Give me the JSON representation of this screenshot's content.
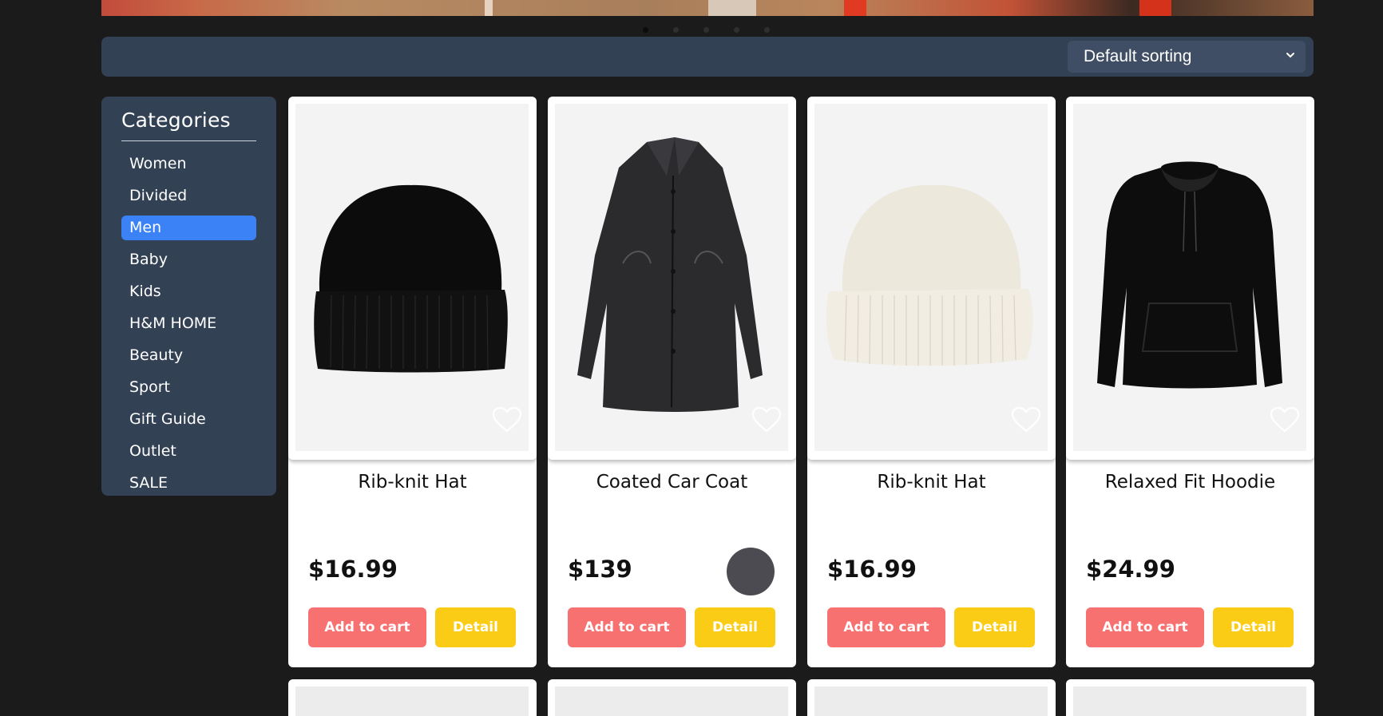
{
  "carousel": {
    "slide_count": 5,
    "active_index": 0
  },
  "sort": {
    "selected": "Default sorting"
  },
  "sidebar": {
    "title": "Categories",
    "items": [
      {
        "label": "Women",
        "active": false
      },
      {
        "label": "Divided",
        "active": false
      },
      {
        "label": "Men",
        "active": true
      },
      {
        "label": "Baby",
        "active": false
      },
      {
        "label": "Kids",
        "active": false
      },
      {
        "label": "H&M HOME",
        "active": false
      },
      {
        "label": "Beauty",
        "active": false
      },
      {
        "label": "Sport",
        "active": false
      },
      {
        "label": "Gift Guide",
        "active": false
      },
      {
        "label": "Outlet",
        "active": false
      },
      {
        "label": "SALE",
        "active": false
      }
    ]
  },
  "products": [
    {
      "name": "Rib-knit Hat",
      "price": "$16.99",
      "image_icon": "black-beanie-icon",
      "add_label": "Add to cart",
      "detail_label": "Detail"
    },
    {
      "name": "Coated Car Coat",
      "price": "$139",
      "image_icon": "black-coat-icon",
      "add_label": "Add to cart",
      "detail_label": "Detail"
    },
    {
      "name": "Rib-knit Hat",
      "price": "$16.99",
      "image_icon": "white-beanie-icon",
      "add_label": "Add to cart",
      "detail_label": "Detail"
    },
    {
      "name": "Relaxed Fit Hoodie",
      "price": "$24.99",
      "image_icon": "black-hoodie-icon",
      "add_label": "Add to cart",
      "detail_label": "Detail"
    }
  ],
  "colors": {
    "background": "#1b1b1b",
    "panel": "#334155",
    "active_category": "#3b82f6",
    "add_to_cart": "#f87171",
    "detail": "#facc15"
  }
}
